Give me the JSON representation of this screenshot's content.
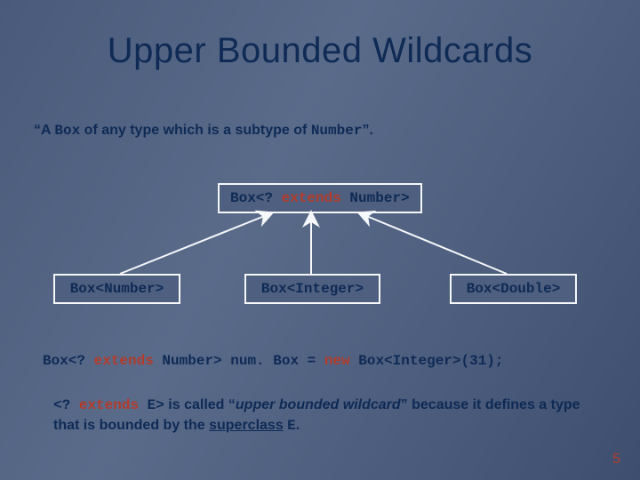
{
  "title": "Upper Bounded Wildcards",
  "sentence": {
    "q1": "“A ",
    "box": "Box",
    "mid": " of any type which is a subtype of ",
    "num": "Number",
    "q2": "”."
  },
  "parent": {
    "pre": "Box<? ",
    "kw": "extends",
    "post": " Number>"
  },
  "children": {
    "number": "Box<Number>",
    "integer": "Box<Integer>",
    "double": "Box<Double>"
  },
  "codeline": {
    "p1": "Box<? ",
    "kw1": "extends",
    "p2": " Number> num. Box = ",
    "kw2": "new",
    "p3": " Box<Integer>(31);"
  },
  "explain": {
    "e1": "<? ",
    "kw": "extends",
    "e2": " E>",
    "e3": " is called “",
    "ital": "upper bounded wildcard",
    "e4": "” because it defines a type that is bounded by the ",
    "under": "superclass",
    "e5": " ",
    "mono2": "E",
    "e6": "."
  },
  "page": "5"
}
